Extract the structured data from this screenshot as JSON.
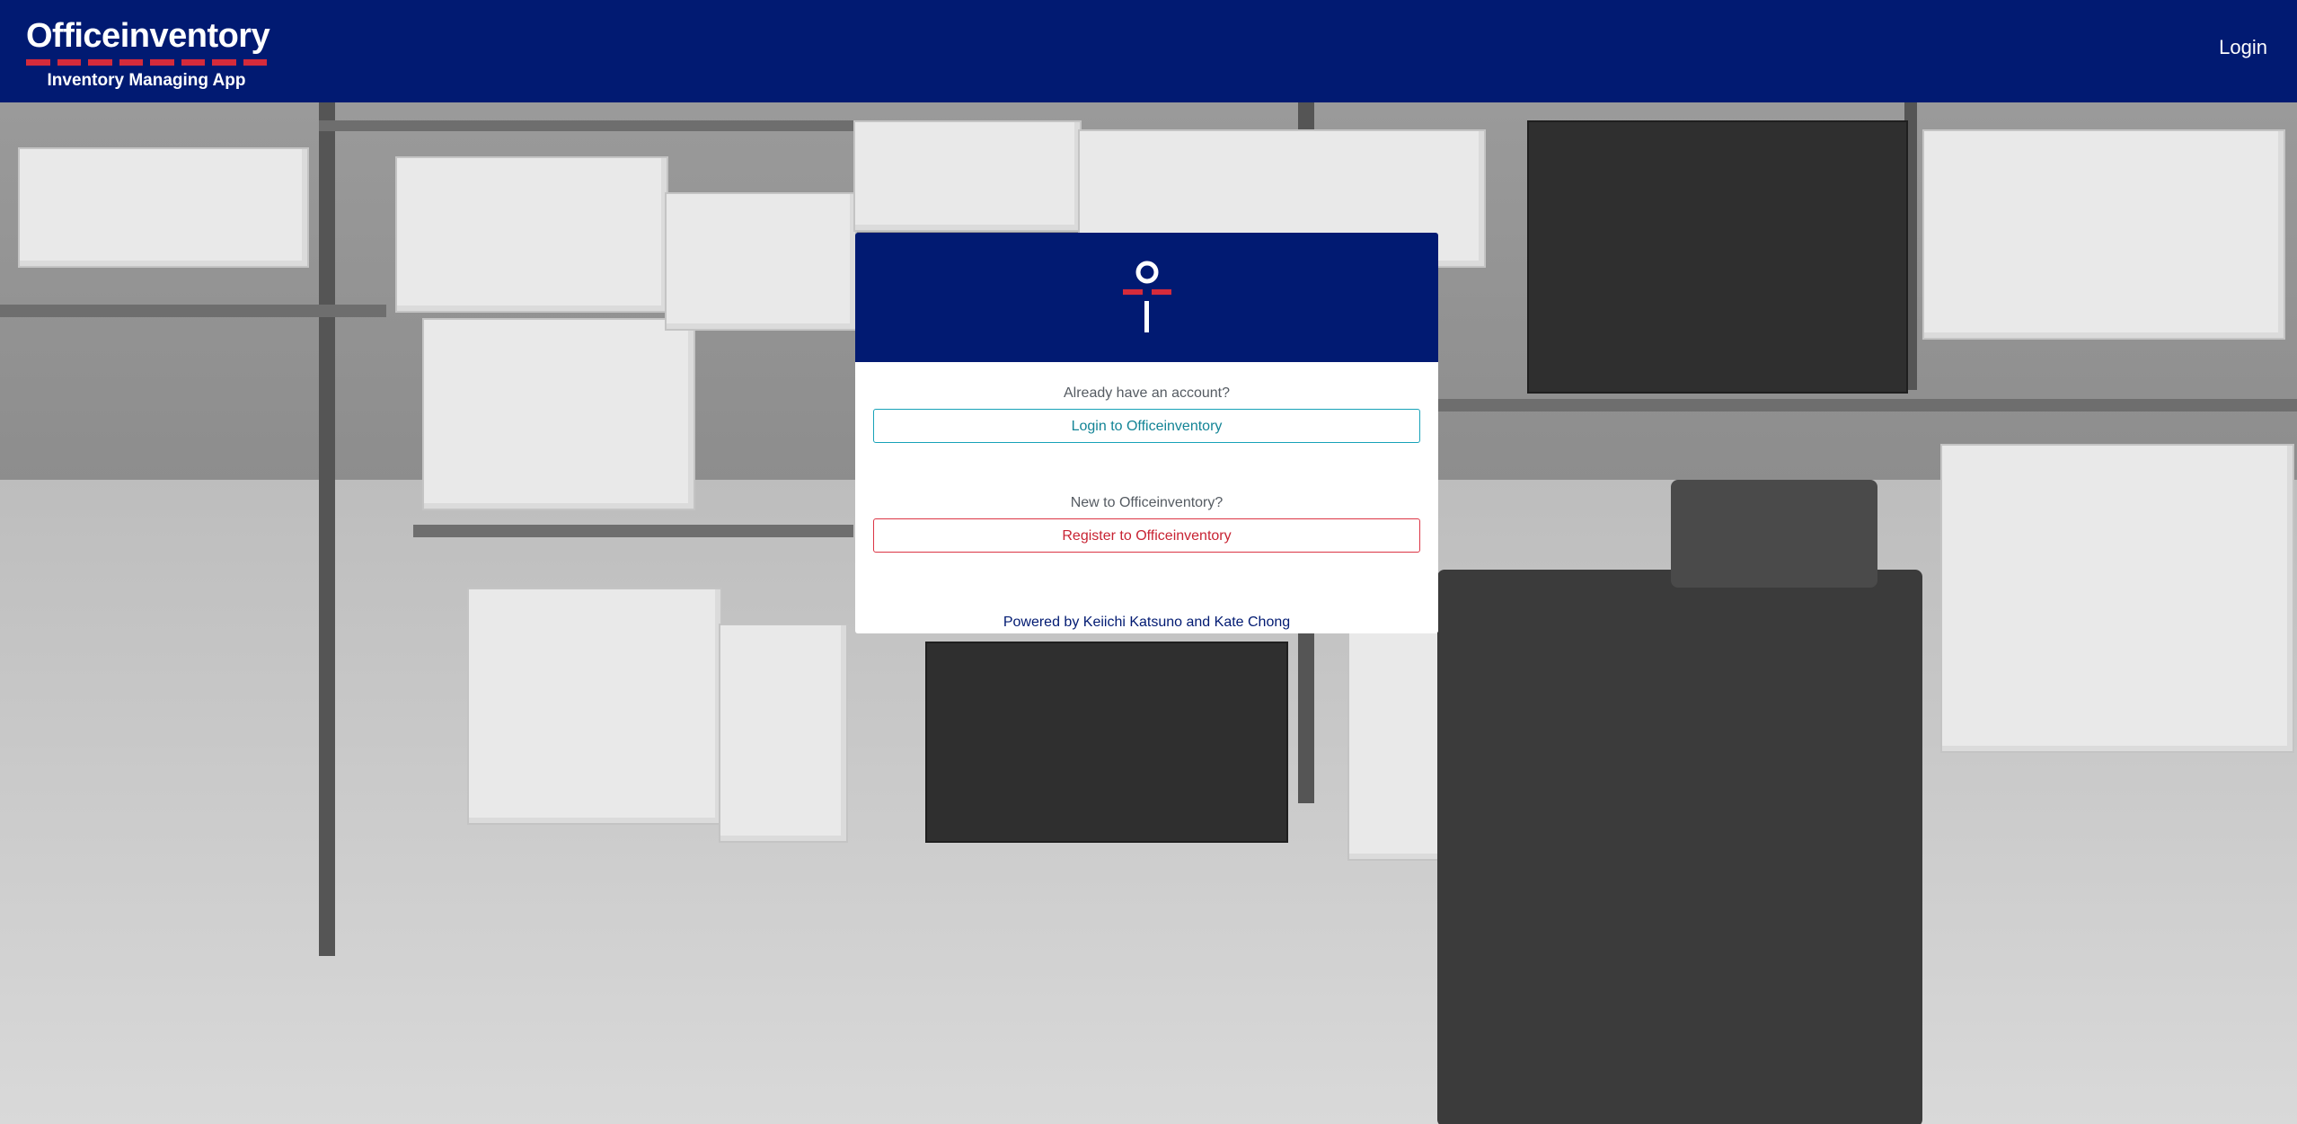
{
  "header": {
    "brand_name": "Officeinventory",
    "tagline": "Inventory Managing App",
    "nav_login": "Login"
  },
  "card": {
    "login_prompt": "Already have an account?",
    "login_button": "Login to Officeinventory",
    "register_prompt": "New to Officeinventory?",
    "register_button": "Register to Officeinventory",
    "powered_by": "Powered by Keiichi Katsuno and Kate Chong"
  },
  "colors": {
    "navy": "#011a72",
    "accent_red": "#d52b3b",
    "login_outline": "#17a2b8",
    "register_outline": "#dc3545"
  },
  "icons": {
    "logo": "officeinventory-i-logo-icon"
  }
}
